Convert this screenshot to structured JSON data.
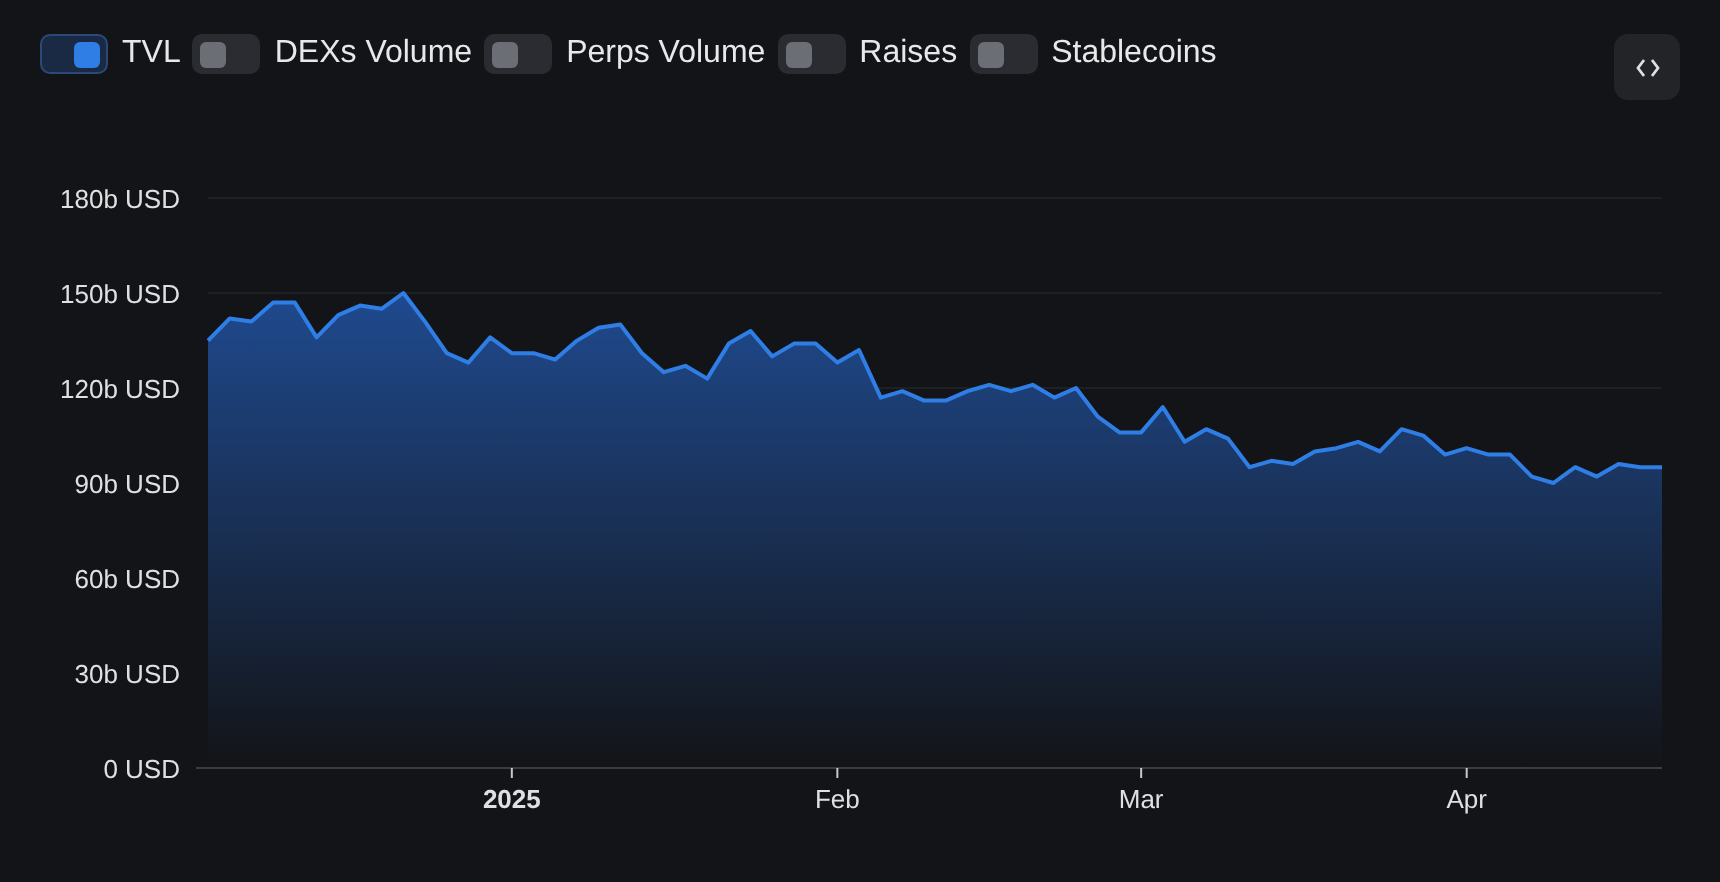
{
  "legend": [
    {
      "label": "TVL",
      "selected": true
    },
    {
      "label": "DEXs Volume",
      "selected": false
    },
    {
      "label": "Perps Volume",
      "selected": false
    },
    {
      "label": "Raises",
      "selected": false
    },
    {
      "label": "Stablecoins",
      "selected": false
    }
  ],
  "chart": {
    "chart_data": {
      "type": "area",
      "categories": [
        null,
        null,
        null,
        null,
        null,
        null,
        null,
        null,
        null,
        null,
        null,
        null,
        null,
        null,
        "2025",
        null,
        null,
        null,
        null,
        null,
        null,
        null,
        null,
        null,
        null,
        null,
        null,
        null,
        null,
        "Feb",
        null,
        null,
        null,
        null,
        null,
        null,
        null,
        null,
        null,
        null,
        null,
        null,
        null,
        "Mar",
        null,
        null,
        null,
        null,
        null,
        null,
        null,
        null,
        null,
        null,
        null,
        null,
        null,
        null,
        "Apr",
        null,
        null,
        null,
        null,
        null,
        null,
        null,
        null,
        null
      ],
      "series": [
        {
          "color": "#2f7ee6",
          "values": [
            135,
            142,
            141,
            147,
            147,
            136,
            143,
            146,
            145,
            150,
            141,
            131,
            128,
            136,
            131,
            131,
            129,
            135,
            139,
            140,
            131,
            125,
            127,
            123,
            134,
            138,
            130,
            134,
            134,
            128,
            132,
            117,
            119,
            116,
            116,
            119,
            121,
            119,
            121,
            117,
            120,
            111,
            106,
            106,
            114,
            103,
            107,
            104,
            95,
            97,
            96,
            100,
            101,
            103,
            100,
            107,
            105,
            99,
            101,
            99,
            99,
            92,
            90,
            95,
            92,
            96,
            95,
            95
          ]
        }
      ],
      "ylim": [
        0,
        180
      ],
      "yticks": [
        {
          "value": 0,
          "label": "0 USD"
        },
        {
          "value": 30,
          "label": "30b USD"
        },
        {
          "value": 60,
          "label": "60b USD"
        },
        {
          "value": 90,
          "label": "90b USD"
        },
        {
          "value": 120,
          "label": "120b USD"
        },
        {
          "value": 150,
          "label": "150b USD"
        },
        {
          "value": 180,
          "label": "180b USD"
        }
      ]
    }
  }
}
